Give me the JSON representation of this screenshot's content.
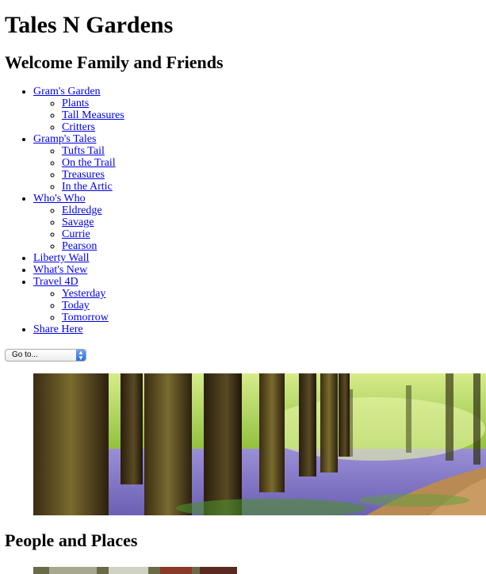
{
  "site": {
    "title": "Tales N Gardens",
    "welcome_heading": "Welcome Family and Friends"
  },
  "nav": {
    "grams_garden": {
      "label": "Gram's Garden",
      "children": [
        "Plants",
        "Tall Measures",
        "Critters"
      ]
    },
    "gramps_tales": {
      "label": "Gramp's Tales",
      "children": [
        "Tufts Tail",
        "On the Trail",
        "Treasures",
        "In the Artic"
      ]
    },
    "whos_who": {
      "label": "Who's Who",
      "children": [
        "Eldredge",
        "Savage",
        "Currie",
        "Pearson"
      ]
    },
    "liberty_wall": {
      "label": "Liberty Wall"
    },
    "whats_new": {
      "label": "What's New"
    },
    "travel_4d": {
      "label": "Travel 4D",
      "children": [
        "Yesterday",
        "Today",
        "Tomorrow"
      ]
    },
    "share_here": {
      "label": "Share Here"
    }
  },
  "goto": {
    "selected": "Go to..."
  },
  "sections": {
    "people_heading": "People and Places"
  },
  "colors": {
    "link": "#0000ee",
    "select_accent": "#2a6fd6"
  }
}
